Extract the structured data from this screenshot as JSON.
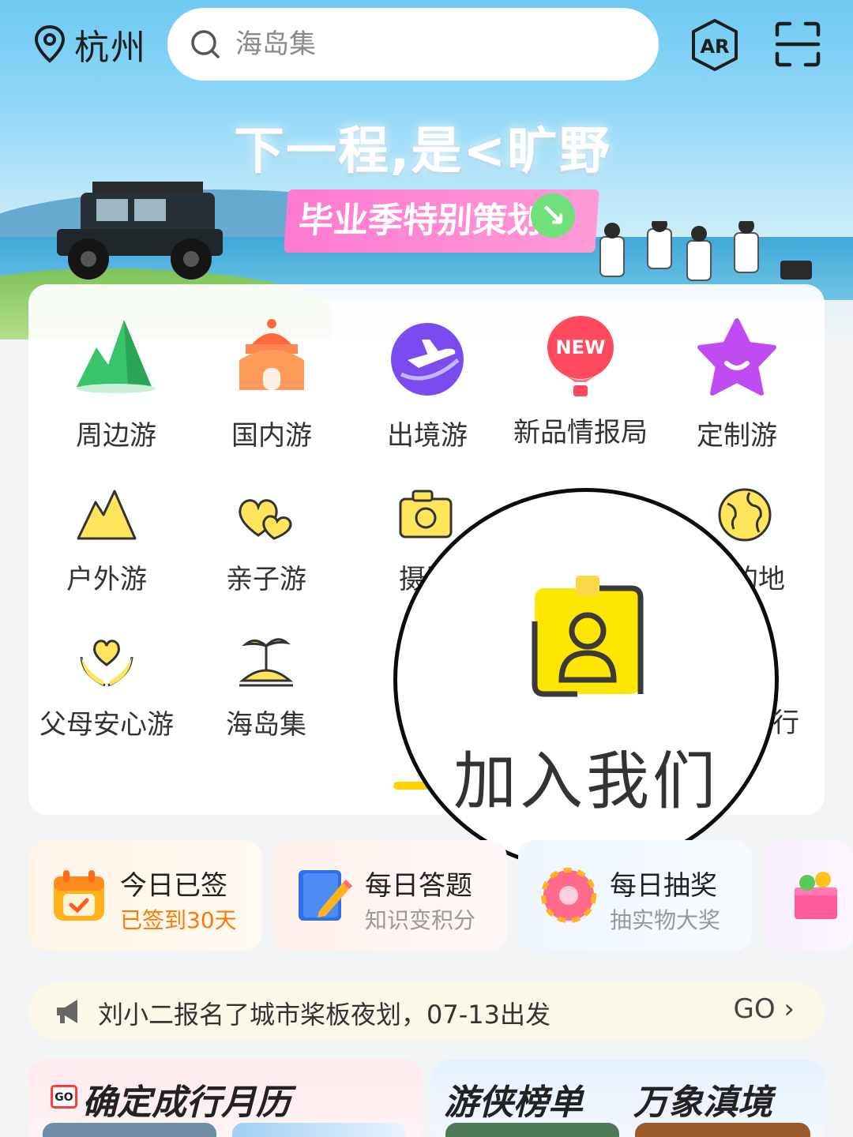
{
  "location": {
    "city": "杭州"
  },
  "search": {
    "placeholder": "海岛集"
  },
  "header_icons": {
    "ar": "ar-icon",
    "scan": "scan-icon"
  },
  "banner": {
    "slogan": "下一程,是<旷野>",
    "tag": "毕业季特别策划"
  },
  "categories_row1": [
    {
      "label": "周边游",
      "icon": "mountain-icon"
    },
    {
      "label": "国内游",
      "icon": "pavilion-icon"
    },
    {
      "label": "出境游",
      "icon": "plane-icon"
    },
    {
      "label": "新品情报局",
      "icon": "balloon-new-icon",
      "badge": "NEW"
    },
    {
      "label": "定制游",
      "icon": "star-icon"
    }
  ],
  "categories_row2": [
    {
      "label": "户外游",
      "icon": "outdoor-mountain-icon"
    },
    {
      "label": "亲子游",
      "icon": "hearts-icon"
    },
    {
      "label": "摄影",
      "icon": "camera-icon"
    },
    {
      "label": "目的地",
      "icon": "globe-icon"
    }
  ],
  "categories_row3": [
    {
      "label": "父母安心游",
      "icon": "hands-heart-icon"
    },
    {
      "label": "海岛集",
      "icon": "island-icon"
    },
    {
      "label": "行",
      "icon": ""
    }
  ],
  "zoom": {
    "label": "加入我们",
    "icon": "badge-id-icon"
  },
  "daily": [
    {
      "title": "今日已签",
      "sub": "已签到30天",
      "icon": "calendar-check-icon",
      "sub_color": "#ff7a00"
    },
    {
      "title": "每日答题",
      "sub": "知识变积分",
      "icon": "notebook-pencil-icon",
      "sub_color": "#999999"
    },
    {
      "title": "每日抽奖",
      "sub": "抽实物大奖",
      "icon": "lottery-wheel-icon",
      "sub_color": "#999999"
    }
  ],
  "notice": {
    "text": "刘小二报名了城市桨板夜划，07-13出发",
    "go": "GO"
  },
  "bottom": {
    "calendar_title": "确定成行月历",
    "calendar_badge": "GO",
    "rank_title": "游侠榜单",
    "scene_title": "万象滇境"
  },
  "colors": {
    "accent": "#ffd200",
    "orange": "#ff7a00"
  }
}
